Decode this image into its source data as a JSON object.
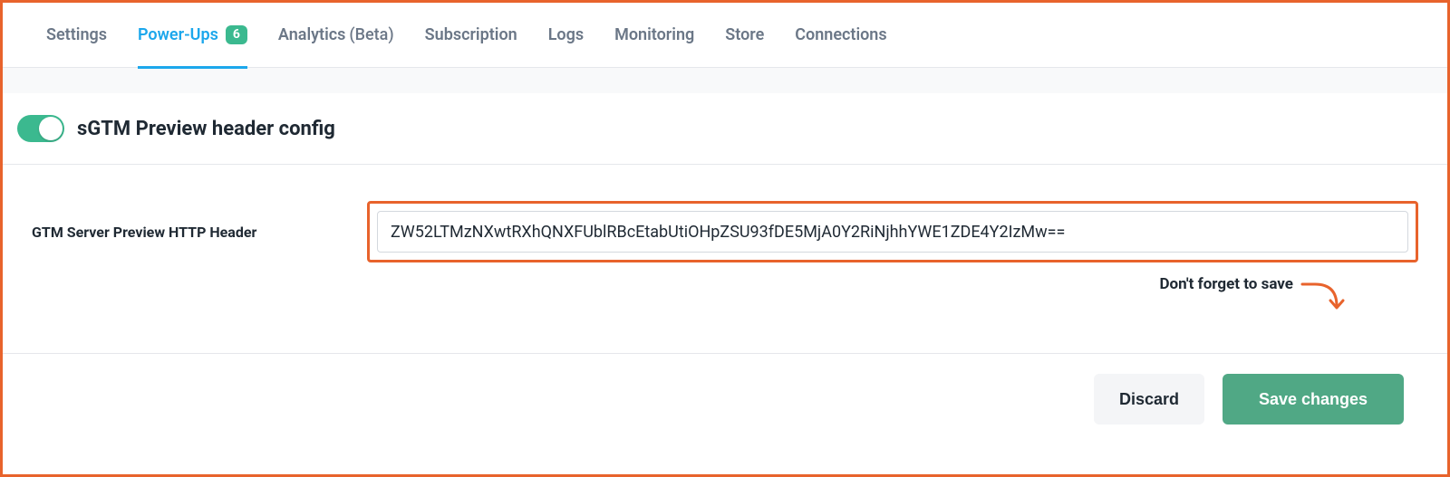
{
  "tabs": [
    {
      "label": "Settings",
      "active": false
    },
    {
      "label": "Power-Ups",
      "active": true,
      "badge": "6"
    },
    {
      "label": "Analytics",
      "suffix": "(Beta)",
      "active": false
    },
    {
      "label": "Subscription",
      "active": false
    },
    {
      "label": "Logs",
      "active": false
    },
    {
      "label": "Monitoring",
      "active": false
    },
    {
      "label": "Store",
      "active": false
    },
    {
      "label": "Connections",
      "active": false
    }
  ],
  "section": {
    "toggle_on": true,
    "title": "sGTM Preview header config"
  },
  "form": {
    "label": "GTM Server Preview HTTP Header",
    "value": "ZW52LTMzNXwtRXhQNXFUblRBcEtabUtiOHpZSU93fDE5MjA0Y2RiNjhhYWE1ZDE4Y2IzMw=="
  },
  "hint": {
    "text": "Don't forget to save"
  },
  "actions": {
    "discard": "Discard",
    "save": "Save changes"
  },
  "colors": {
    "callout": "#e8632c",
    "accent_blue": "#1ca7ec",
    "accent_green": "#3bb98f",
    "primary_btn": "#50a885"
  }
}
